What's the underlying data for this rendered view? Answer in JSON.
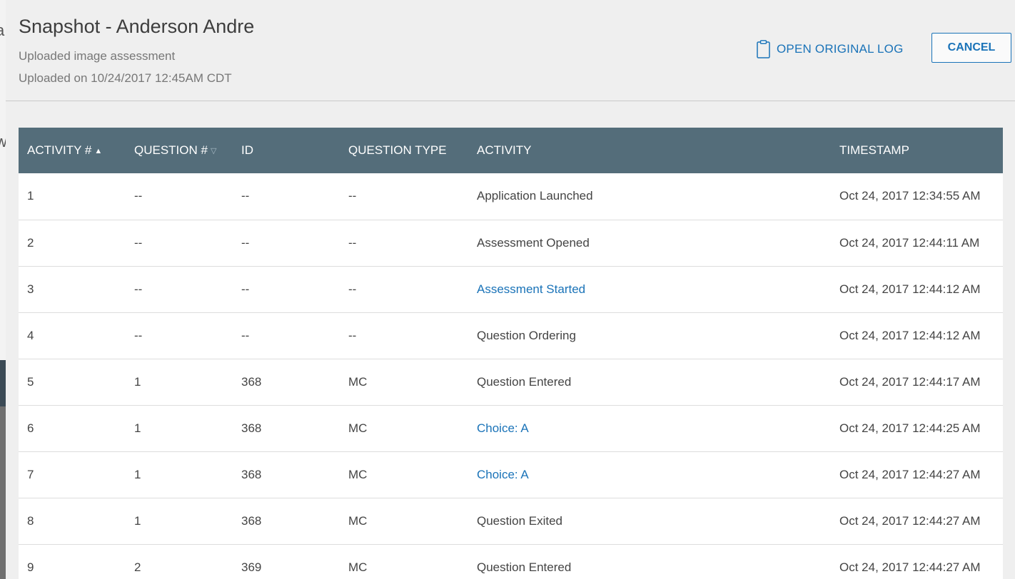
{
  "backdrop": {
    "letters": [
      "a",
      "w"
    ]
  },
  "header": {
    "title": "Snapshot - Anderson Andre",
    "subtitle": "Uploaded image assessment",
    "uploaded": "Uploaded on 10/24/2017 12:45AM CDT",
    "open_log_label": "OPEN ORIGINAL LOG",
    "cancel_label": "CANCEL"
  },
  "table": {
    "columns": [
      {
        "label": "ACTIVITY #",
        "sort": "asc"
      },
      {
        "label": "QUESTION #",
        "sort": "desc"
      },
      {
        "label": "ID",
        "sort": ""
      },
      {
        "label": "QUESTION TYPE",
        "sort": ""
      },
      {
        "label": "ACTIVITY",
        "sort": ""
      },
      {
        "label": "TIMESTAMP",
        "sort": ""
      }
    ],
    "rows": [
      {
        "activity_num": "1",
        "question_num": "--",
        "id": "--",
        "question_type": "--",
        "activity": "Application Launched",
        "link": false,
        "timestamp": "Oct 24, 2017 12:34:55 AM"
      },
      {
        "activity_num": "2",
        "question_num": "--",
        "id": "--",
        "question_type": "--",
        "activity": "Assessment Opened",
        "link": false,
        "timestamp": "Oct 24, 2017 12:44:11 AM"
      },
      {
        "activity_num": "3",
        "question_num": "--",
        "id": "--",
        "question_type": "--",
        "activity": "Assessment Started",
        "link": true,
        "timestamp": "Oct 24, 2017 12:44:12 AM"
      },
      {
        "activity_num": "4",
        "question_num": "--",
        "id": "--",
        "question_type": "--",
        "activity": "Question Ordering",
        "link": false,
        "timestamp": "Oct 24, 2017 12:44:12 AM"
      },
      {
        "activity_num": "5",
        "question_num": "1",
        "id": "368",
        "question_type": "MC",
        "activity": "Question Entered",
        "link": false,
        "timestamp": "Oct 24, 2017 12:44:17 AM"
      },
      {
        "activity_num": "6",
        "question_num": "1",
        "id": "368",
        "question_type": "MC",
        "activity": "Choice: A",
        "link": true,
        "timestamp": "Oct 24, 2017 12:44:25 AM"
      },
      {
        "activity_num": "7",
        "question_num": "1",
        "id": "368",
        "question_type": "MC",
        "activity": "Choice: A",
        "link": true,
        "timestamp": "Oct 24, 2017 12:44:27 AM"
      },
      {
        "activity_num": "8",
        "question_num": "1",
        "id": "368",
        "question_type": "MC",
        "activity": "Question Exited",
        "link": false,
        "timestamp": "Oct 24, 2017 12:44:27 AM"
      },
      {
        "activity_num": "9",
        "question_num": "2",
        "id": "369",
        "question_type": "MC",
        "activity": "Question Entered",
        "link": false,
        "timestamp": "Oct 24, 2017 12:44:27 AM"
      }
    ]
  },
  "colors": {
    "accent": "#1a73b8",
    "table_header": "#546d7a",
    "page_bg": "#efefef"
  },
  "icons": {
    "open_log": "clipboard-icon",
    "sort_asc": "sort-asc-icon",
    "sort_desc": "sort-desc-icon"
  }
}
